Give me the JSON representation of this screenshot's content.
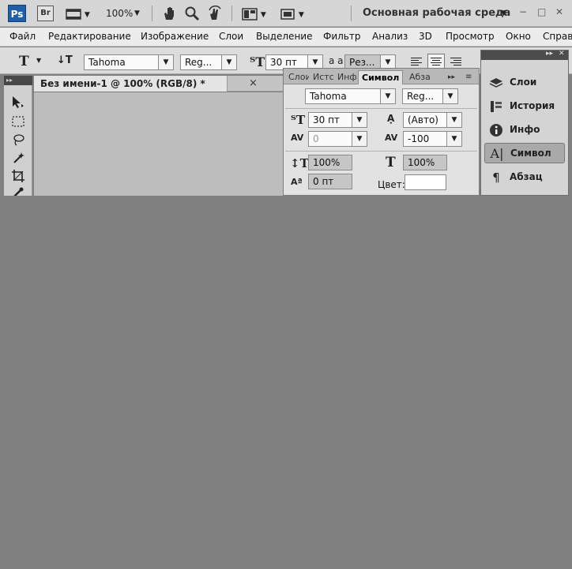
{
  "appbar": {
    "ps_logo": "Ps",
    "br_logo": "Br",
    "zoom": "100%",
    "workspace": "Основная рабочая среда",
    "dropdown_arrow": "▼"
  },
  "menu": [
    "Файл",
    "Редактирование",
    "Изображение",
    "Слои",
    "Выделение",
    "Фильтр",
    "Анализ",
    "3D",
    "Просмотр",
    "Окно",
    "Справ"
  ],
  "options": {
    "tool_glyph": "T",
    "font_family": "Tahoma",
    "font_style": "Reg...",
    "font_size": "30 пт",
    "aa_label": "a a",
    "aa_mode": "Рез..."
  },
  "document": {
    "tab_title": "Без имени-1 @ 100% (RGB/8) *",
    "close": "×"
  },
  "character_panel": {
    "tabs": [
      "Слои",
      "Истс",
      "Инфо",
      "Символ",
      "Абза"
    ],
    "font_family": "Tahoma",
    "font_style": "Reg...",
    "font_size": "30 пт",
    "leading": "(Авто)",
    "kerning": "0",
    "tracking": "-100",
    "vertical_scale": "100%",
    "horizontal_scale": "100%",
    "baseline_shift": "0 пт",
    "color_label": "Цвет:"
  },
  "dock": {
    "items": [
      {
        "label": "Слои",
        "icon": "layers-icon"
      },
      {
        "label": "История",
        "icon": "history-icon"
      },
      {
        "label": "Инфо",
        "icon": "info-icon"
      },
      {
        "label": "Символ",
        "icon": "character-icon"
      },
      {
        "label": "Абзац",
        "icon": "paragraph-icon"
      }
    ]
  }
}
